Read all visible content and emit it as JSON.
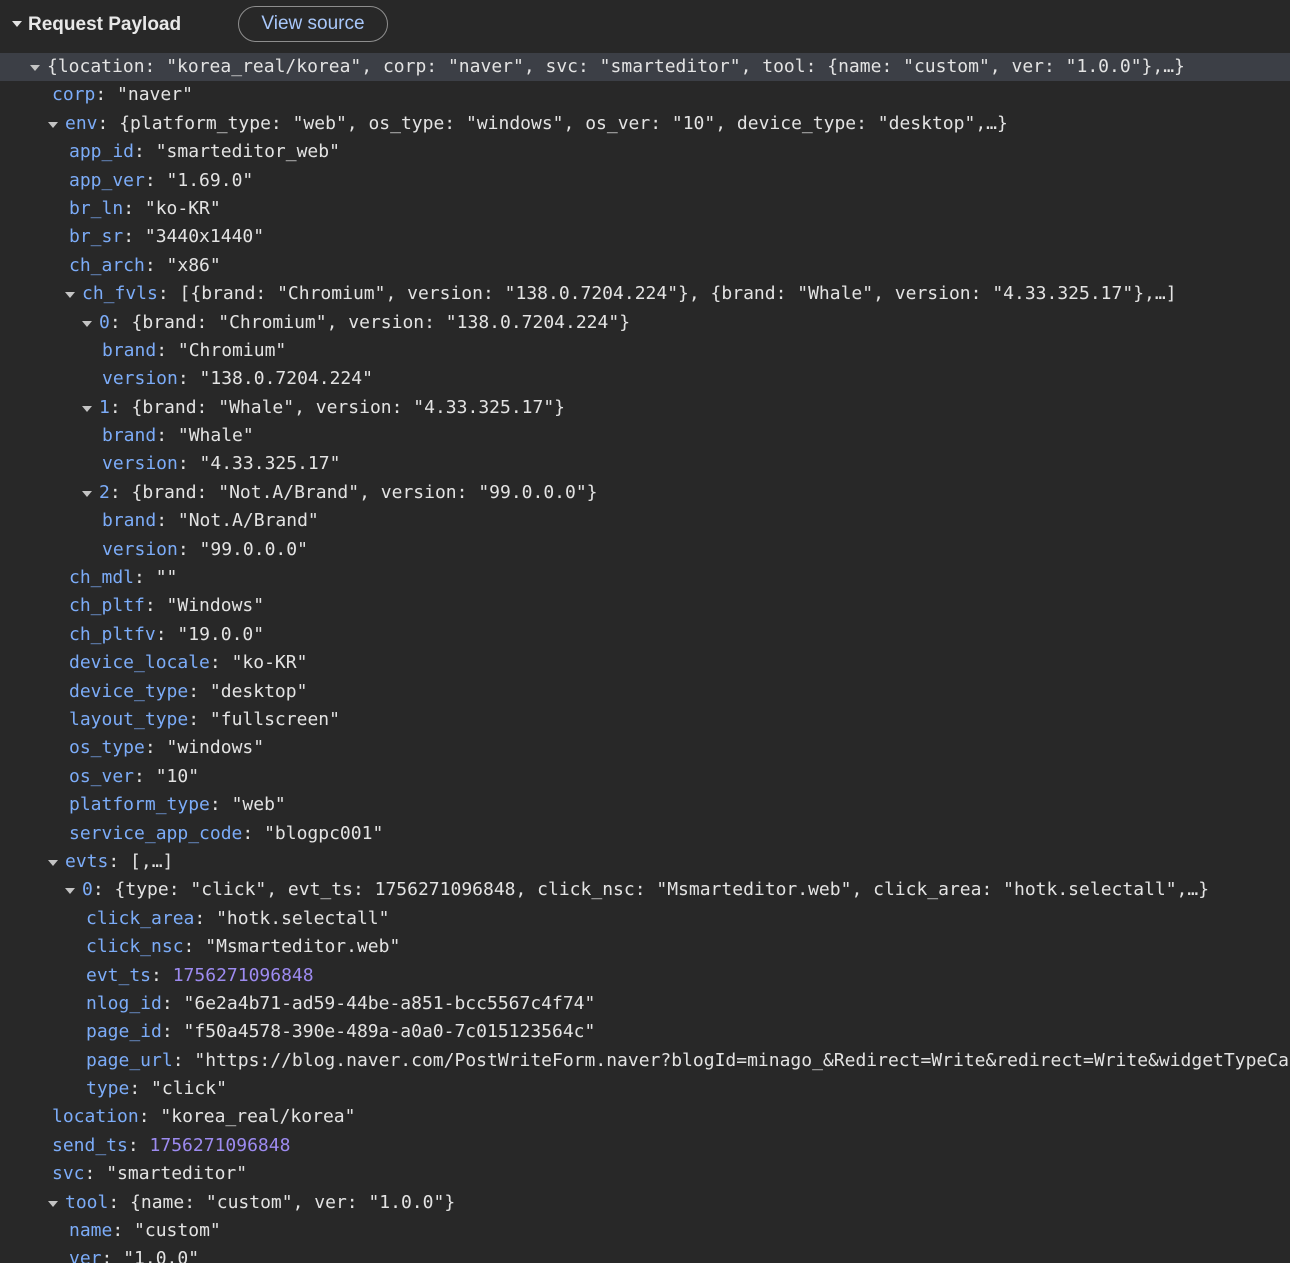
{
  "header": {
    "title": "Request Payload",
    "view_source_label": "View source"
  },
  "rows": [
    {
      "summary": "{location: \"korea_real/korea\", corp: \"naver\", svc: \"smarteditor\", tool: {name: \"custom\", ver: \"1.0.0\"},…}"
    },
    {
      "key": "corp",
      "value": "\"naver\""
    },
    {
      "key": "env",
      "summary": "{platform_type: \"web\", os_type: \"windows\", os_ver: \"10\", device_type: \"desktop\",…}"
    },
    {
      "key": "app_id",
      "value": "\"smarteditor_web\""
    },
    {
      "key": "app_ver",
      "value": "\"1.69.0\""
    },
    {
      "key": "br_ln",
      "value": "\"ko-KR\""
    },
    {
      "key": "br_sr",
      "value": "\"3440x1440\""
    },
    {
      "key": "ch_arch",
      "value": "\"x86\""
    },
    {
      "key": "ch_fvls",
      "summary": "[{brand: \"Chromium\", version: \"138.0.7204.224\"}, {brand: \"Whale\", version: \"4.33.325.17\"},…]"
    },
    {
      "key": "0",
      "summary": "{brand: \"Chromium\", version: \"138.0.7204.224\"}"
    },
    {
      "key": "brand",
      "value": "\"Chromium\""
    },
    {
      "key": "version",
      "value": "\"138.0.7204.224\""
    },
    {
      "key": "1",
      "summary": "{brand: \"Whale\", version: \"4.33.325.17\"}"
    },
    {
      "key": "brand",
      "value": "\"Whale\""
    },
    {
      "key": "version",
      "value": "\"4.33.325.17\""
    },
    {
      "key": "2",
      "summary": "{brand: \"Not.A/Brand\", version: \"99.0.0.0\"}"
    },
    {
      "key": "brand",
      "value": "\"Not.A/Brand\""
    },
    {
      "key": "version",
      "value": "\"99.0.0.0\""
    },
    {
      "key": "ch_mdl",
      "value": "\"\""
    },
    {
      "key": "ch_pltf",
      "value": "\"Windows\""
    },
    {
      "key": "ch_pltfv",
      "value": "\"19.0.0\""
    },
    {
      "key": "device_locale",
      "value": "\"ko-KR\""
    },
    {
      "key": "device_type",
      "value": "\"desktop\""
    },
    {
      "key": "layout_type",
      "value": "\"fullscreen\""
    },
    {
      "key": "os_type",
      "value": "\"windows\""
    },
    {
      "key": "os_ver",
      "value": "\"10\""
    },
    {
      "key": "platform_type",
      "value": "\"web\""
    },
    {
      "key": "service_app_code",
      "value": "\"blogpc001\""
    },
    {
      "key": "evts",
      "summary": "[,…]"
    },
    {
      "key": "0",
      "summary": "{type: \"click\", evt_ts: 1756271096848, click_nsc: \"Msmarteditor.web\", click_area: \"hotk.selectall\",…}"
    },
    {
      "key": "click_area",
      "value": "\"hotk.selectall\""
    },
    {
      "key": "click_nsc",
      "value": "\"Msmarteditor.web\""
    },
    {
      "key": "evt_ts",
      "value": "1756271096848",
      "number": true
    },
    {
      "key": "nlog_id",
      "value": "\"6e2a4b71-ad59-44be-a851-bcc5567c4f74\""
    },
    {
      "key": "page_id",
      "value": "\"f50a4578-390e-489a-a0a0-7c015123564c\""
    },
    {
      "key": "page_url",
      "value": "\"https://blog.naver.com/PostWriteForm.naver?blogId=minago_&Redirect=Write&redirect=Write&widgetTypeCall=true&p"
    },
    {
      "key": "type",
      "value": "\"click\""
    },
    {
      "key": "location",
      "value": "\"korea_real/korea\""
    },
    {
      "key": "send_ts",
      "value": "1756271096848",
      "number": true
    },
    {
      "key": "svc",
      "value": "\"smarteditor\""
    },
    {
      "key": "tool",
      "summary": "{name: \"custom\", ver: \"1.0.0\"}"
    },
    {
      "key": "name",
      "value": "\"custom\""
    },
    {
      "key": "ver",
      "value": "\"1.0.0\""
    }
  ]
}
